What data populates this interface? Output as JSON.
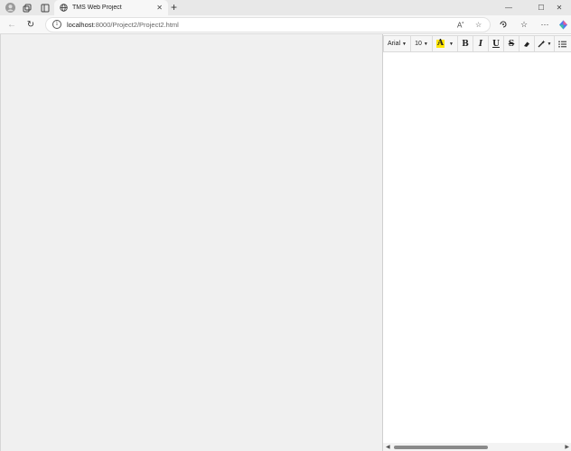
{
  "browser": {
    "tab": {
      "title": "TMS Web Project",
      "close_label": "✕"
    },
    "new_tab_label": "+",
    "window_controls": {
      "minimize": "—",
      "maximize": "☐",
      "close": "✕"
    },
    "address": {
      "host": "localhost",
      "path": ":8000/Project2/Project2.html"
    }
  },
  "editor_toolbar": {
    "font_family": "Arial",
    "font_size": "10",
    "highlight_label": "A",
    "highlight_color": "#ffe600",
    "bold_label": "B",
    "italic_label": "I",
    "underline_label": "U",
    "strike_label": "S"
  }
}
